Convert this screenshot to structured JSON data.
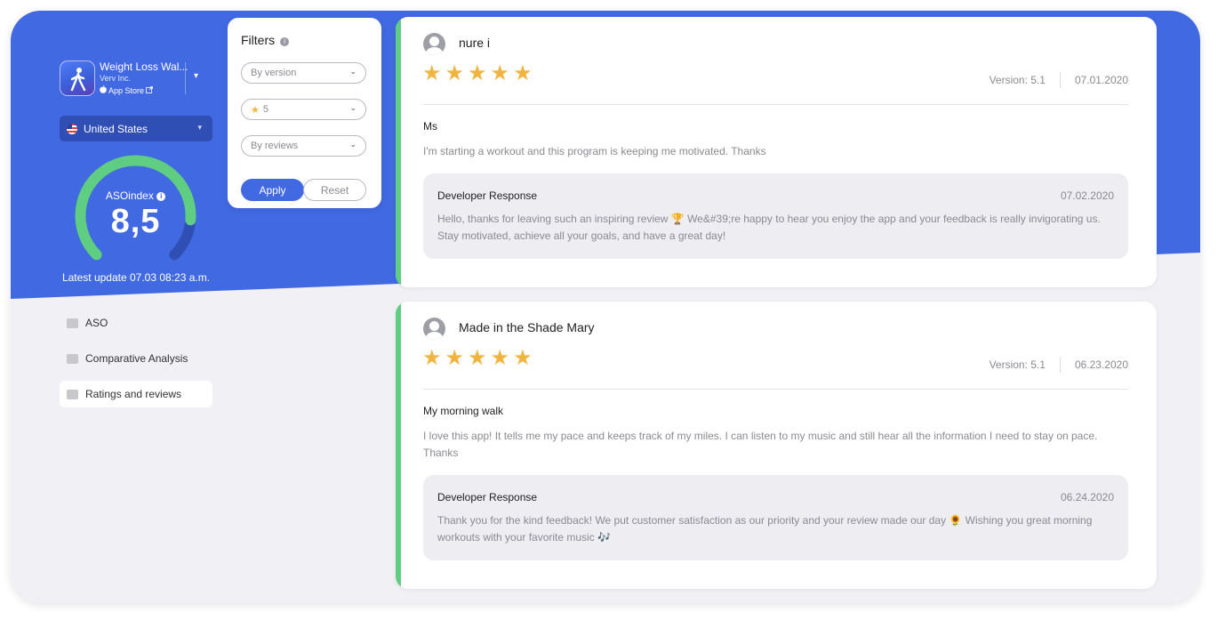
{
  "app": {
    "name": "Weight Loss Wal...",
    "developer": "Verv Inc.",
    "store": "App Store"
  },
  "country": {
    "label": "United States"
  },
  "aso": {
    "label": "ASOindex",
    "value": "8,5",
    "gauge_fraction": 0.85,
    "latest_update": "Latest update 07.03 08:23 a.m."
  },
  "nav": [
    {
      "label": "ASO",
      "active": false
    },
    {
      "label": "Comparative Analysis",
      "active": false
    },
    {
      "label": "Ratings and reviews",
      "active": true
    }
  ],
  "filters": {
    "title": "Filters",
    "version_placeholder": "By version",
    "rating_value": "5",
    "sort_placeholder": "By reviews",
    "apply_label": "Apply",
    "reset_label": "Reset"
  },
  "reviews": [
    {
      "author": "nure i",
      "rating": 5,
      "version": "Version: 5.1",
      "date": "07.01.2020",
      "title": "Ms",
      "body": "I'm starting a workout and this program is keeping me motivated. Thanks",
      "response_title": "Developer Response",
      "response_date": "07.02.2020",
      "response_body": "Hello, thanks for leaving such an inspiring review 🏆 We&#39;re happy to hear you enjoy the app and your feedback is really invigorating us. Stay motivated, achieve all your goals, and have a great day!"
    },
    {
      "author": "Made in the Shade Mary",
      "rating": 5,
      "version": "Version: 5.1",
      "date": "06.23.2020",
      "title": "My morning walk",
      "body": "I love this app! It tells me my pace and keeps track of my miles. I can listen to my music and still hear all the information I need to stay on pace. Thanks",
      "response_title": "Developer Response",
      "response_date": "06.24.2020",
      "response_body": "Thank you for the kind feedback! We put customer satisfaction as our priority and your review made our day 🌻 Wishing you great morning workouts with your favorite music 🎶"
    }
  ],
  "colors": {
    "brand_blue": "#4169e1",
    "accent_green": "#5fce82",
    "star_gold": "#f2b440"
  }
}
